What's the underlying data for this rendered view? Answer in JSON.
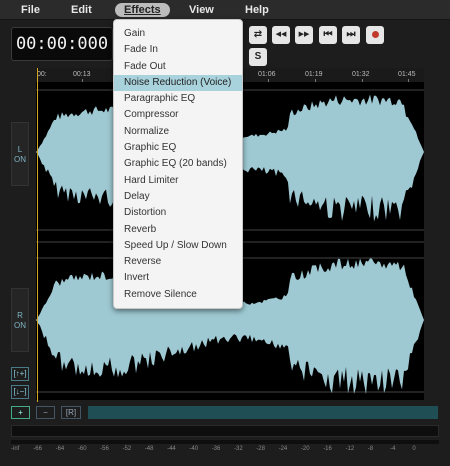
{
  "menu": {
    "file": "File",
    "edit": "Edit",
    "effects": "Effects",
    "view": "View",
    "help": "Help"
  },
  "timecode": "00:00:000",
  "controls": {
    "loop_icon": "⇄",
    "rewind_icon": "◀◀",
    "forward_icon": "▶▶",
    "skip_start_icon": "⏮",
    "skip_end_icon": "⏭",
    "record_icon": "record-icon",
    "s_label": "S"
  },
  "timeline": {
    "ticks": [
      "00:",
      "00:13",
      "01:06",
      "01:19",
      "01:32",
      "01:45"
    ]
  },
  "channels": {
    "left": {
      "name": "L",
      "state": "ON"
    },
    "right": {
      "name": "R",
      "state": "ON"
    }
  },
  "side_buttons": {
    "zoom_in_v": "[↑+]",
    "zoom_out_v": "[↓−]",
    "plus": "+",
    "minus": "−",
    "range": "[R]"
  },
  "meter_labels": [
    "-inf",
    "-66",
    "-64",
    "-60",
    "-56",
    "-52",
    "-48",
    "-44",
    "-40",
    "-36",
    "-32",
    "-28",
    "-24",
    "-20",
    "-16",
    "-12",
    "-8",
    "-4",
    "0"
  ],
  "effects_menu": {
    "items": [
      "Gain",
      "Fade In",
      "Fade Out",
      "Noise Reduction (Voice)",
      "Paragraphic EQ",
      "Compressor",
      "Normalize",
      "Graphic EQ",
      "Graphic EQ (20 bands)",
      "Hard Limiter",
      "Delay",
      "Distortion",
      "Reverb",
      "Speed Up / Slow Down",
      "Reverse",
      "Invert",
      "Remove Silence"
    ],
    "highlighted_index": 3
  },
  "colors": {
    "waveform": "#9ec9d3",
    "accent": "#a8d2dc",
    "cursor": "#d6a51e"
  }
}
